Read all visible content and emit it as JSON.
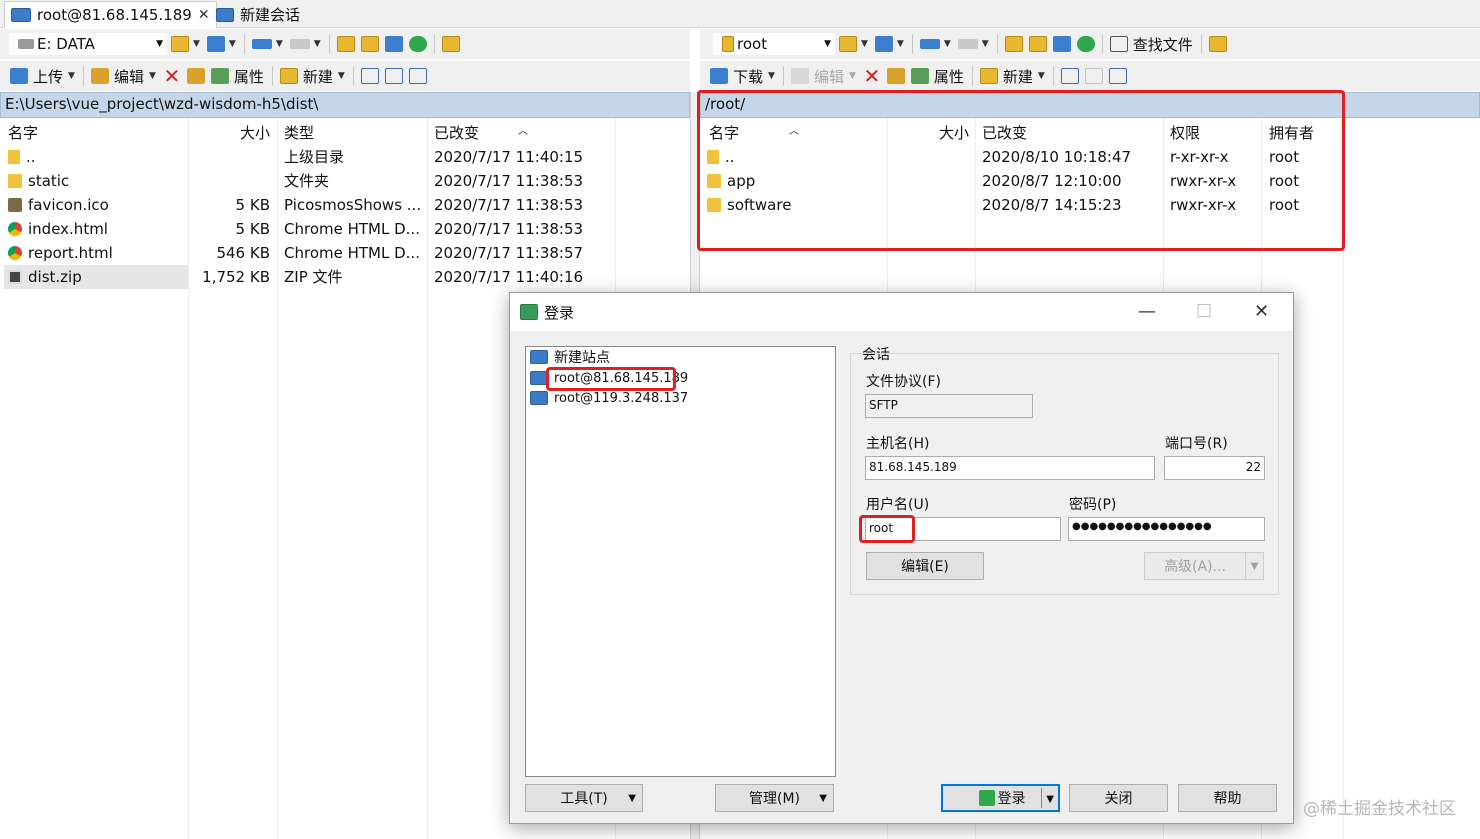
{
  "tabs": [
    {
      "label": "root@81.68.145.189",
      "close": "✕"
    },
    {
      "label": "新建会话"
    }
  ],
  "left": {
    "drive": "E: DATA",
    "toolbar": {
      "upload": "上传",
      "edit": "编辑",
      "properties": "属性",
      "new": "新建"
    },
    "path": "E:\\Users\\vue_project\\wzd-wisdom-h5\\dist\\",
    "columns": {
      "name": "名字",
      "size": "大小",
      "type": "类型",
      "modified": "已改变"
    },
    "files": [
      {
        "name": "..",
        "size": "",
        "type": "上级目录",
        "modified": "2020/7/17  11:40:15"
      },
      {
        "name": "static",
        "size": "",
        "type": "文件夹",
        "modified": "2020/7/17  11:38:53"
      },
      {
        "name": "favicon.ico",
        "size": "5 KB",
        "type": "PicosmosShows ...",
        "modified": "2020/7/17  11:38:53"
      },
      {
        "name": "index.html",
        "size": "5 KB",
        "type": "Chrome HTML D...",
        "modified": "2020/7/17  11:38:53"
      },
      {
        "name": "report.html",
        "size": "546 KB",
        "type": "Chrome HTML D...",
        "modified": "2020/7/17  11:38:57"
      },
      {
        "name": "dist.zip",
        "size": "1,752 KB",
        "type": "ZIP 文件",
        "modified": "2020/7/17  11:40:16"
      }
    ]
  },
  "right": {
    "dir": "root",
    "toolbar": {
      "find": "查找文件",
      "download": "下载",
      "edit": "编辑",
      "properties": "属性",
      "new": "新建"
    },
    "path": "/root/",
    "columns": {
      "name": "名字",
      "size": "大小",
      "modified": "已改变",
      "perms": "权限",
      "owner": "拥有者"
    },
    "files": [
      {
        "name": "..",
        "modified": "2020/8/10 10:18:47",
        "perms": "r-xr-xr-x",
        "owner": "root"
      },
      {
        "name": "app",
        "modified": "2020/8/7 12:10:00",
        "perms": "rwxr-xr-x",
        "owner": "root"
      },
      {
        "name": "software",
        "modified": "2020/8/7 14:15:23",
        "perms": "rwxr-xr-x",
        "owner": "root"
      }
    ]
  },
  "dialog": {
    "title": "登录",
    "sites": [
      "新建站点",
      "root@81.68.145.189",
      "root@119.3.248.137"
    ],
    "session_label": "会话",
    "protocol_label": "文件协议(F)",
    "protocol_value": "SFTP",
    "host_label": "主机名(H)",
    "host_value": "81.68.145.189",
    "port_label": "端口号(R)",
    "port_value": "22",
    "user_label": "用户名(U)",
    "user_value": "root",
    "password_label": "密码(P)",
    "password_value": "●●●●●●●●●●●●●●●●",
    "edit_button": "编辑(E)",
    "advanced_button": "高级(A)...",
    "tools_button": "工具(T)",
    "manage_button": "管理(M)",
    "login_button": "登录",
    "close_button": "关闭",
    "help_button": "帮助"
  },
  "watermark": "@稀土掘金技术社区"
}
